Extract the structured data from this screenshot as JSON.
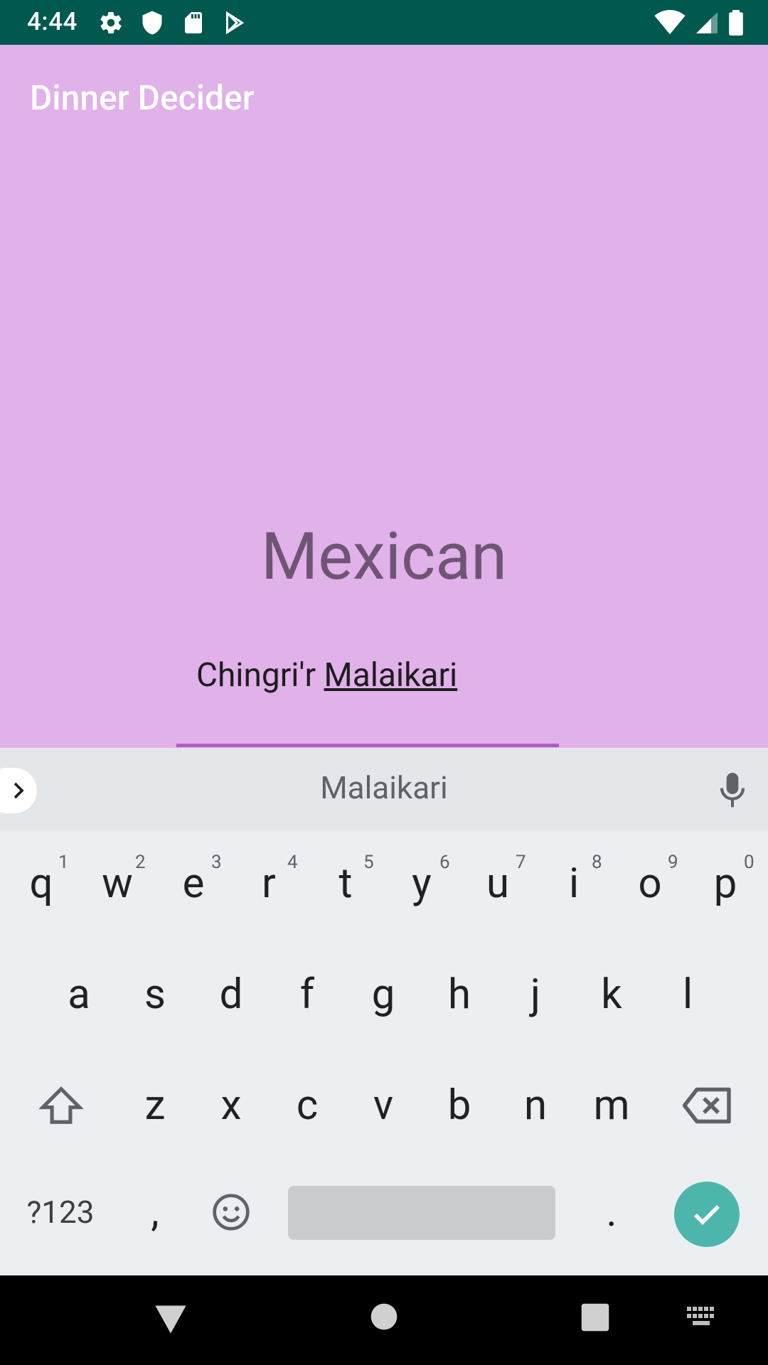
{
  "status_bar": {
    "time": "4:44",
    "left_icons": [
      "settings-icon",
      "shield-icon",
      "sd-card-icon",
      "play-store-icon"
    ],
    "right_icons": [
      "wifi-icon",
      "signal-icon",
      "battery-icon"
    ]
  },
  "app_bar": {
    "title": "Dinner Decider"
  },
  "main": {
    "result": "Mexican",
    "input_prefix": "Chingri'r",
    "input_composing": "Malaikari"
  },
  "keyboard": {
    "suggestion": "Malaikari",
    "row1": [
      {
        "key": "q",
        "hint": "1"
      },
      {
        "key": "w",
        "hint": "2"
      },
      {
        "key": "e",
        "hint": "3"
      },
      {
        "key": "r",
        "hint": "4"
      },
      {
        "key": "t",
        "hint": "5"
      },
      {
        "key": "y",
        "hint": "6"
      },
      {
        "key": "u",
        "hint": "7"
      },
      {
        "key": "i",
        "hint": "8"
      },
      {
        "key": "o",
        "hint": "9"
      },
      {
        "key": "p",
        "hint": "0"
      }
    ],
    "row2": [
      "a",
      "s",
      "d",
      "f",
      "g",
      "h",
      "j",
      "k",
      "l"
    ],
    "row3": [
      "z",
      "x",
      "c",
      "v",
      "b",
      "n",
      "m"
    ],
    "symbols_label": "?123",
    "comma": ",",
    "period": ".",
    "colors": {
      "enter": "#4db6ac",
      "accent_line": "#ad5fc1"
    }
  },
  "nav_bar": {
    "icons": [
      "back-icon",
      "home-icon",
      "recents-icon",
      "keyboard-icon"
    ]
  }
}
